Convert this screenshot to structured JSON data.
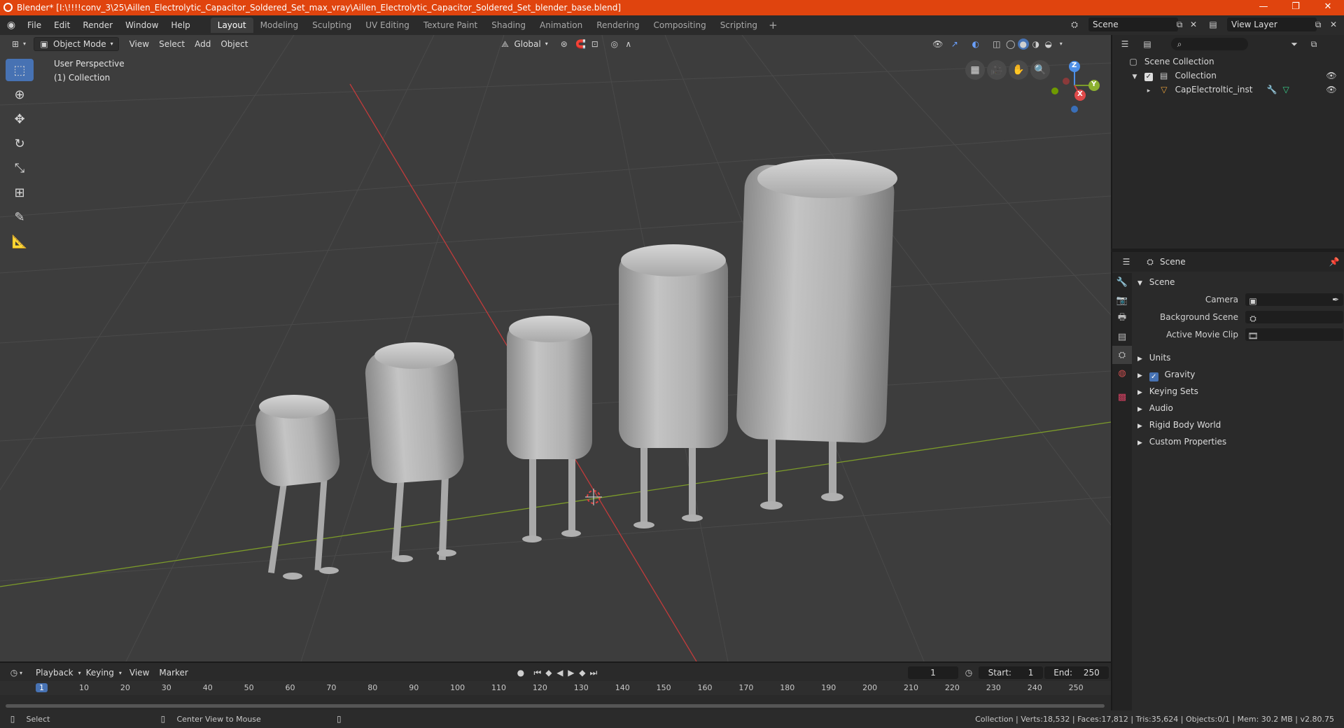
{
  "window": {
    "title": "Blender* [I:\\!!!!conv_3\\25\\Aillen_Electrolytic_Capacitor_Soldered_Set_max_vray\\Aillen_Electrolytic_Capacitor_Soldered_Set_blender_base.blend]",
    "minimize": "—",
    "maximize": "❐",
    "close": "✕"
  },
  "menu": [
    "File",
    "Edit",
    "Render",
    "Window",
    "Help"
  ],
  "workspaces": [
    "Layout",
    "Modeling",
    "Sculpting",
    "UV Editing",
    "Texture Paint",
    "Shading",
    "Animation",
    "Rendering",
    "Compositing",
    "Scripting"
  ],
  "workspace_add": "+",
  "scene_name": "Scene",
  "view_layer": "View Layer",
  "viewport": {
    "mode": "Object Mode",
    "menus": [
      "View",
      "Select",
      "Add",
      "Object"
    ],
    "transform": "Global",
    "perspective": "User Perspective",
    "collection": "(1) Collection",
    "gizmo": {
      "z": "Z",
      "y": "Y",
      "x": "X"
    }
  },
  "outliner": {
    "root": "Scene Collection",
    "collection": "Collection",
    "object": "CapElectroltic_inst"
  },
  "properties": {
    "header": "Scene",
    "panel": "Scene",
    "fields": [
      {
        "label": "Camera"
      },
      {
        "label": "Background Scene"
      },
      {
        "label": "Active Movie Clip"
      }
    ],
    "sections": [
      "Units",
      "Gravity",
      "Keying Sets",
      "Audio",
      "Rigid Body World",
      "Custom Properties"
    ]
  },
  "timeline": {
    "menus": [
      "Playback",
      "Keying",
      "View",
      "Marker"
    ],
    "current_frame": "1",
    "start_label": "Start:",
    "start": "1",
    "end_label": "End:",
    "end": "250",
    "ticks": [
      "1",
      "10",
      "20",
      "30",
      "40",
      "50",
      "60",
      "70",
      "80",
      "90",
      "100",
      "110",
      "120",
      "130",
      "140",
      "150",
      "160",
      "170",
      "180",
      "190",
      "200",
      "210",
      "220",
      "230",
      "240",
      "250"
    ]
  },
  "status": {
    "left1": "Select",
    "left2": "Center View to Mouse",
    "right": "Collection | Verts:18,532 | Faces:17,812 | Tris:35,624 | Objects:0/1 | Mem: 30.2 MB | v2.80.75"
  },
  "colors": {
    "accent": "#4772b3",
    "titlebar": "#e0440e",
    "x_axis": "#c23b3b",
    "y_axis": "#7c9b2a"
  }
}
